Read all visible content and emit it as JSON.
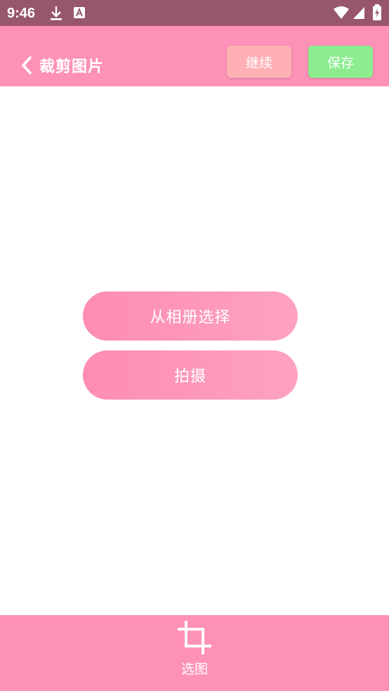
{
  "status_bar": {
    "time": "9:46",
    "icons": [
      "download-icon",
      "a-badge-icon",
      "wifi-icon",
      "signal-icon",
      "battery-charging-icon"
    ]
  },
  "app_bar": {
    "back_icon": "chevron-left-icon",
    "title": "裁剪图片",
    "continue_label": "继续",
    "save_label": "保存"
  },
  "main": {
    "album_label": "从相册选择",
    "shoot_label": "拍摄"
  },
  "bottom_bar": {
    "tab_icon": "crop-icon",
    "tab_label": "选图"
  },
  "colors": {
    "status_bar": "#98566c",
    "app_bar": "#fe91b8",
    "continue_button": "#feb0b5",
    "save_button": "#8cec8e",
    "pill_start": "#fe8cb4",
    "pill_end": "#fea2c0",
    "bottom_bar": "#fe91b8"
  }
}
